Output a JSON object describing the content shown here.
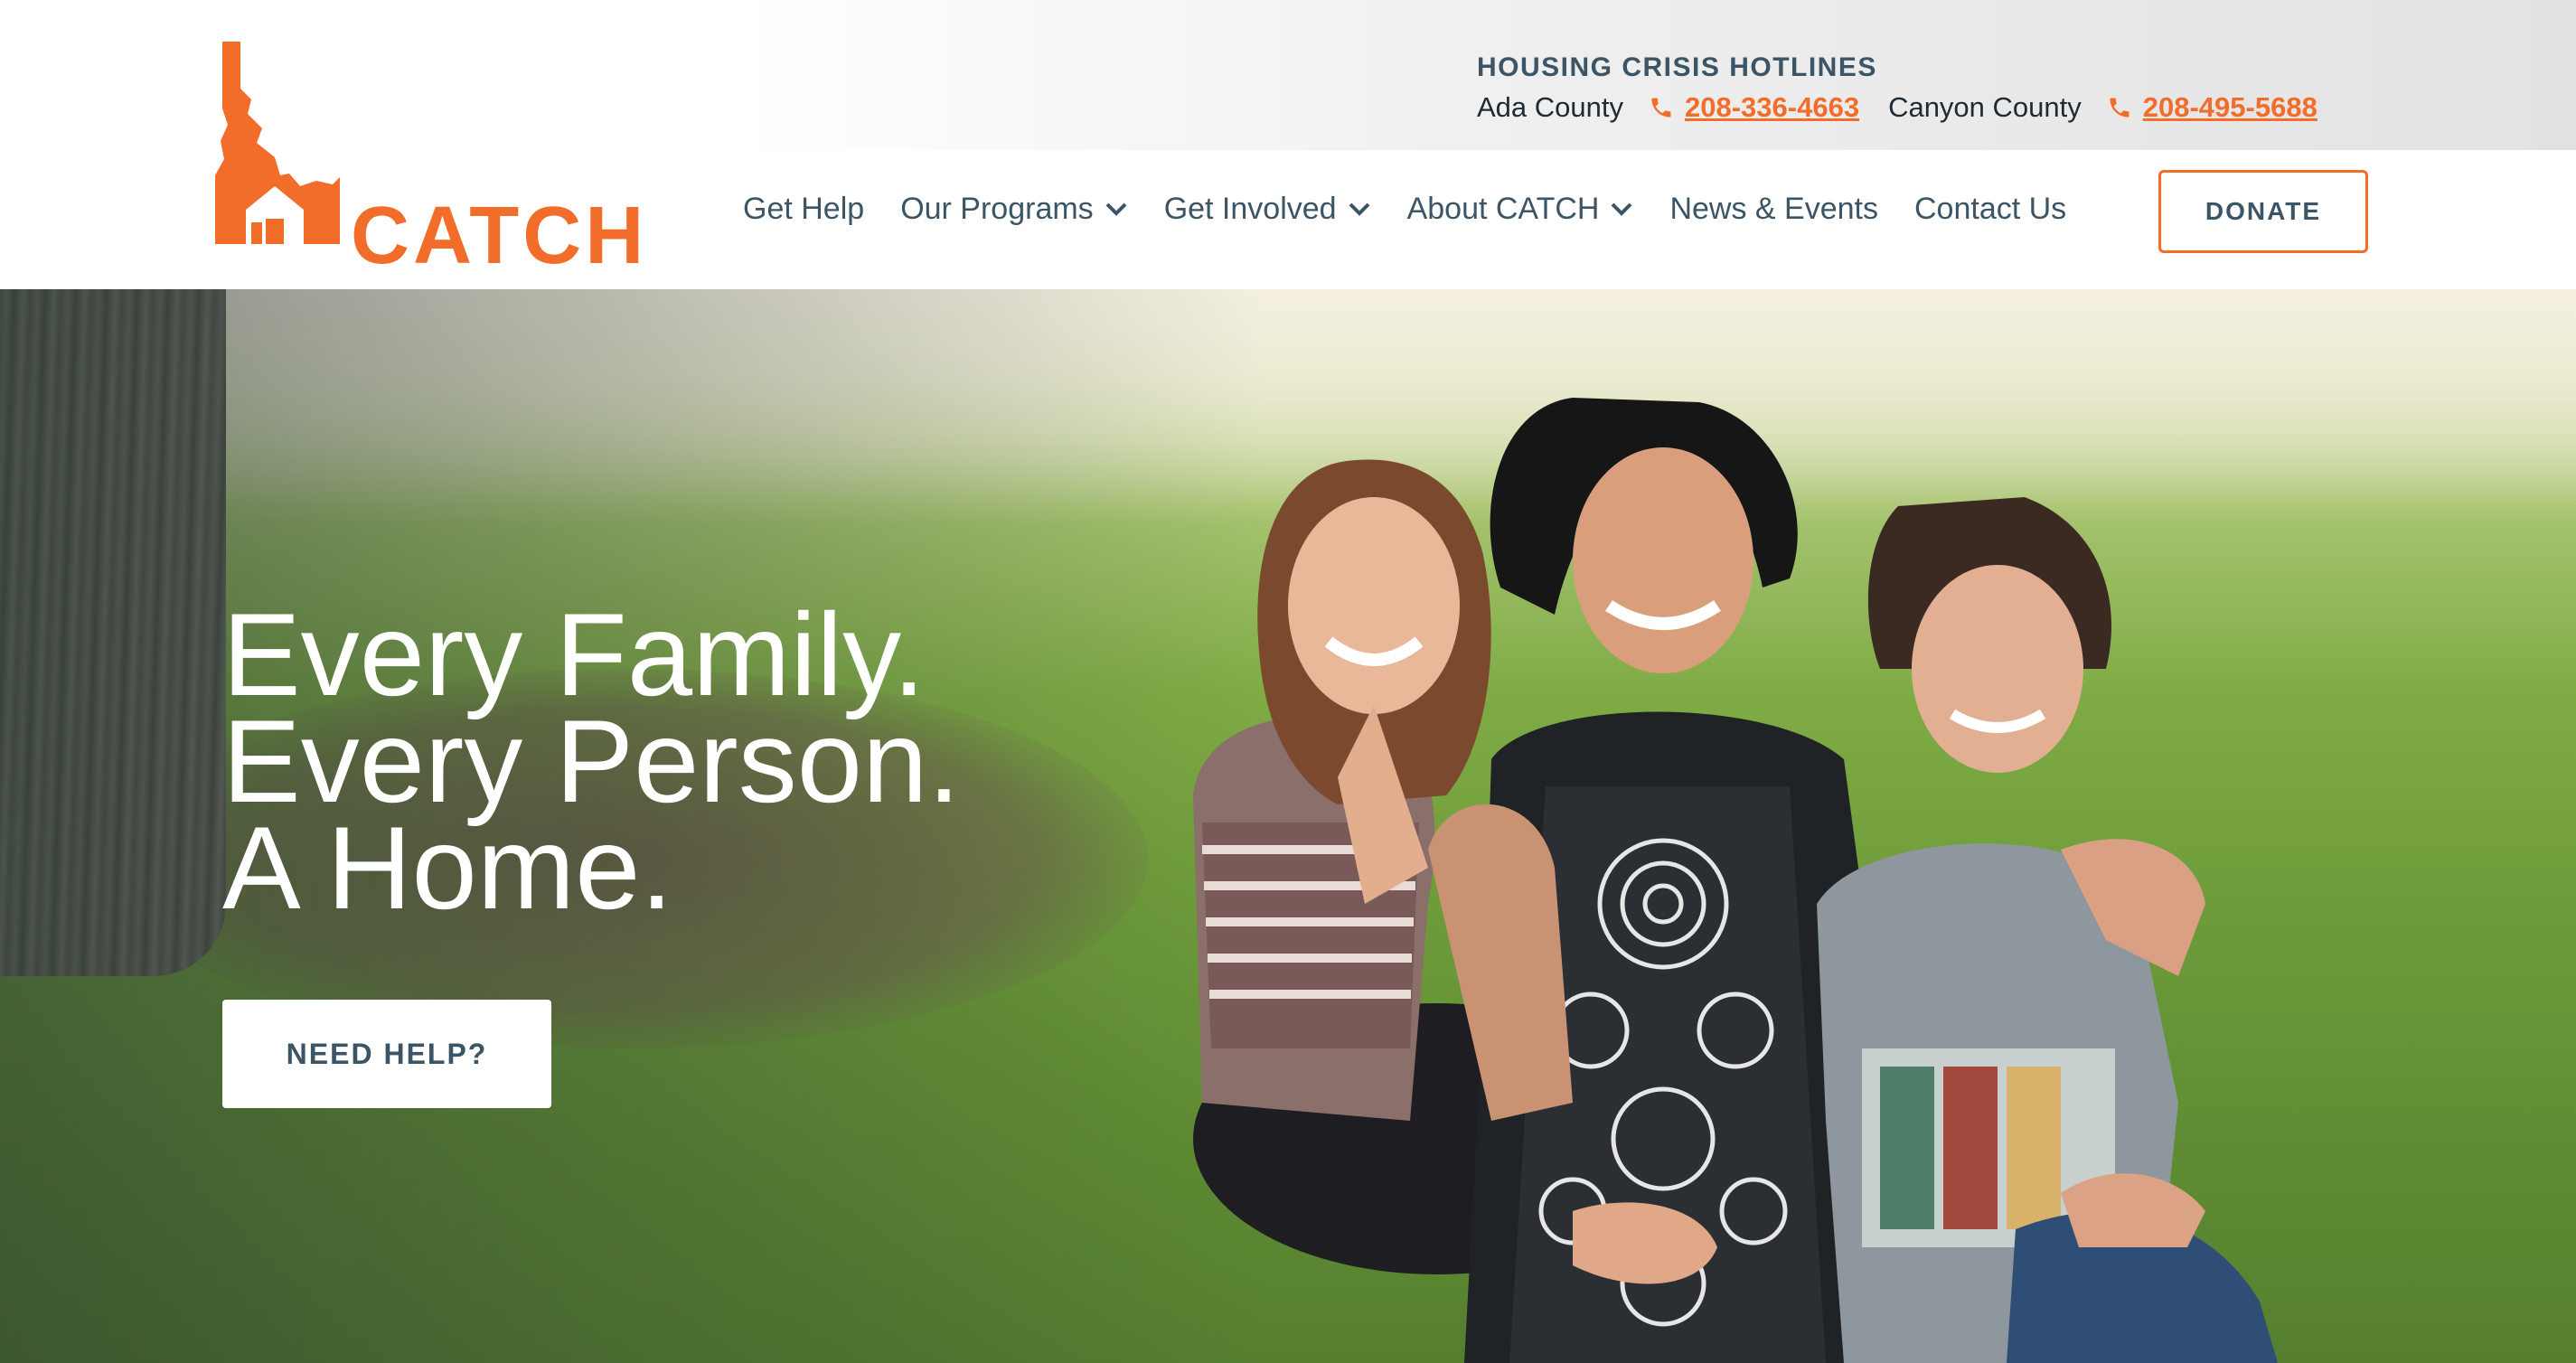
{
  "brand": {
    "name": "CATCH",
    "accent_color": "#f26c2a",
    "text_color": "#3c5566"
  },
  "hotlines": {
    "title": "HOUSING CRISIS HOTLINES",
    "entries": [
      {
        "county": "Ada County",
        "phone": "208-336-4663",
        "icon": "phone-icon"
      },
      {
        "county": "Canyon County",
        "phone": "208-495-5688",
        "icon": "phone-icon"
      }
    ]
  },
  "nav": {
    "items": [
      {
        "label": "Get Help",
        "has_dropdown": false
      },
      {
        "label": "Our Programs",
        "has_dropdown": true
      },
      {
        "label": "Get Involved",
        "has_dropdown": true
      },
      {
        "label": "About CATCH",
        "has_dropdown": true
      },
      {
        "label": "News & Events",
        "has_dropdown": false
      },
      {
        "label": "Contact Us",
        "has_dropdown": false
      }
    ],
    "donate_label": "DONATE"
  },
  "hero": {
    "title_lines": [
      "Every Family.",
      "Every Person.",
      "A Home."
    ],
    "cta_label": "NEED HELP?"
  }
}
